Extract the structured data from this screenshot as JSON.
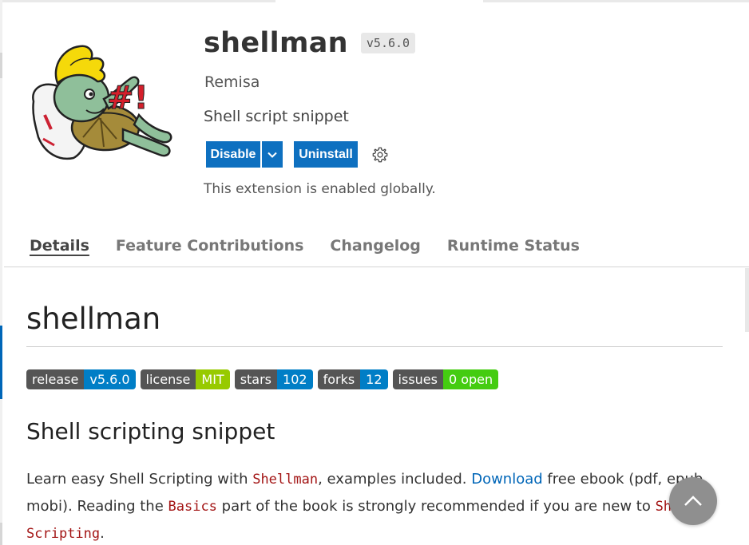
{
  "extension": {
    "name": "shellman",
    "version": "v5.6.0",
    "publisher": "Remisa",
    "description": "Shell script snippet",
    "status": "This extension is enabled globally.",
    "logo_icon": "shellman-turtle-logo",
    "logo_text": "#!"
  },
  "actions": {
    "disable_label": "Disable",
    "dropdown_icon": "chevron-down-icon",
    "uninstall_label": "Uninstall",
    "settings_icon": "gear-icon",
    "accent_color": "#0e70c0"
  },
  "tabs": [
    {
      "label": "Details",
      "active": true
    },
    {
      "label": "Feature Contributions",
      "active": false
    },
    {
      "label": "Changelog",
      "active": false
    },
    {
      "label": "Runtime Status",
      "active": false
    }
  ],
  "readme": {
    "title": "shellman",
    "badges": [
      {
        "label": "release",
        "value": "v5.6.0",
        "color": "#007ec6"
      },
      {
        "label": "license",
        "value": "MIT",
        "color": "#97ca00"
      },
      {
        "label": "stars",
        "value": "102",
        "color": "#007ec6"
      },
      {
        "label": "forks",
        "value": "12",
        "color": "#007ec6"
      },
      {
        "label": "issues",
        "value": "0 open",
        "color": "#4c1"
      }
    ],
    "heading": "Shell scripting snippet",
    "paragraph": {
      "t1": "Learn easy Shell Scripting with ",
      "code1": "Shellman",
      "t2": ", examples included. ",
      "link": "Download",
      "t3": " free ebook (pdf, epub, mobi). Reading the ",
      "code2": "Basics",
      "t4": " part of the book is strongly recommended if you are new to ",
      "code3": "Shell Scripting",
      "t5": "."
    }
  },
  "scroll_top_icon": "chevron-up-icon"
}
